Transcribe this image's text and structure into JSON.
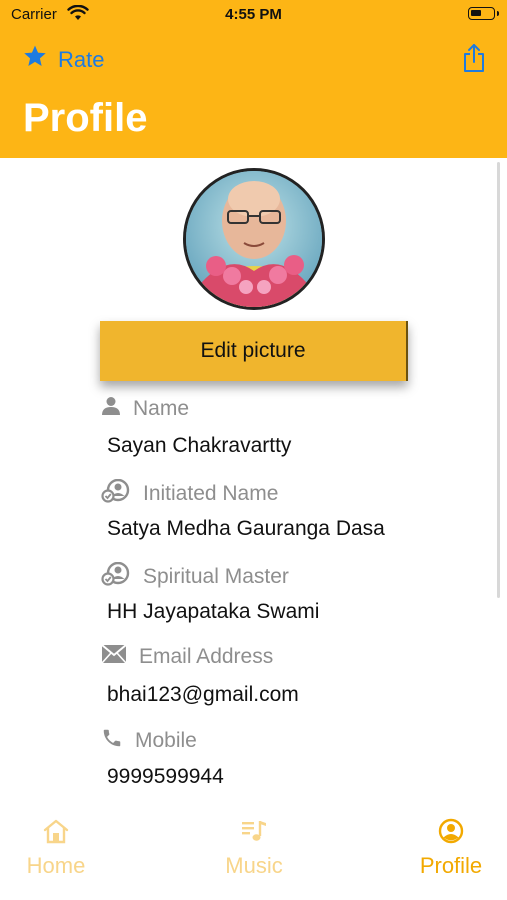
{
  "status_bar": {
    "carrier": "Carrier",
    "time": "4:55 PM"
  },
  "header": {
    "rate_label": "Rate",
    "title": "Profile"
  },
  "profile": {
    "edit_button": "Edit picture"
  },
  "fields": [
    {
      "label": "Name",
      "value": "Sayan Chakravartty",
      "icon": "person-icon"
    },
    {
      "label": "Initiated Name",
      "value": "Satya Medha Gauranga Dasa",
      "icon": "person-badge-icon"
    },
    {
      "label": "Spiritual Master",
      "value": "HH Jayapataka Swami",
      "icon": "person-badge-icon"
    },
    {
      "label": "Email Address",
      "value": "bhai123@gmail.com",
      "icon": "envelope-icon"
    },
    {
      "label": "Mobile",
      "value": "9999599944",
      "icon": "phone-icon"
    }
  ],
  "tabs": [
    {
      "label": "Home",
      "icon": "home-icon",
      "active": false
    },
    {
      "label": "Music",
      "icon": "music-icon",
      "active": false
    },
    {
      "label": "Profile",
      "icon": "profile-icon",
      "active": true
    }
  ],
  "colors": {
    "header": "#FDB515",
    "accent_blue": "#1E7BE0",
    "button": "#F0B52D",
    "tab_active": "#F2A900",
    "tab_inactive": "#F8D58A"
  }
}
